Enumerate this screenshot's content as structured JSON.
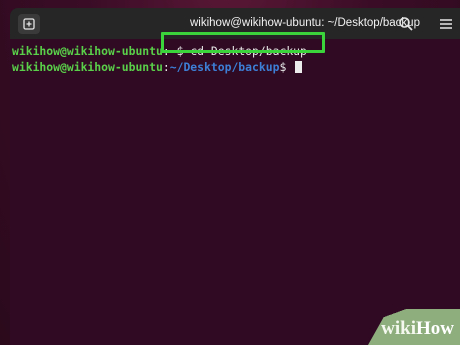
{
  "window": {
    "title": "wikihow@wikihow-ubuntu: ~/Desktop/backup"
  },
  "terminal": {
    "lines": [
      {
        "user_host": "wikihow@wikihow-ubuntu",
        "sep": ":",
        "path": "~",
        "prompt": "$ ",
        "command": "cd Desktop/backup"
      },
      {
        "user_host": "wikihow@wikihow-ubuntu",
        "sep": ":",
        "path": "~/Desktop/backup",
        "prompt": "$ ",
        "command": ""
      }
    ]
  },
  "watermark": {
    "part1": "wiki",
    "part2": "How"
  },
  "colors": {
    "background": "#3a0c26",
    "terminal_bg": "#2f0a22",
    "titlebar": "#262626",
    "prompt_user": "#5ad04a",
    "prompt_path": "#3d7fd6",
    "highlight": "#3bd43b"
  },
  "icons": [
    "new-tab-icon",
    "search-icon",
    "menu-icon"
  ]
}
